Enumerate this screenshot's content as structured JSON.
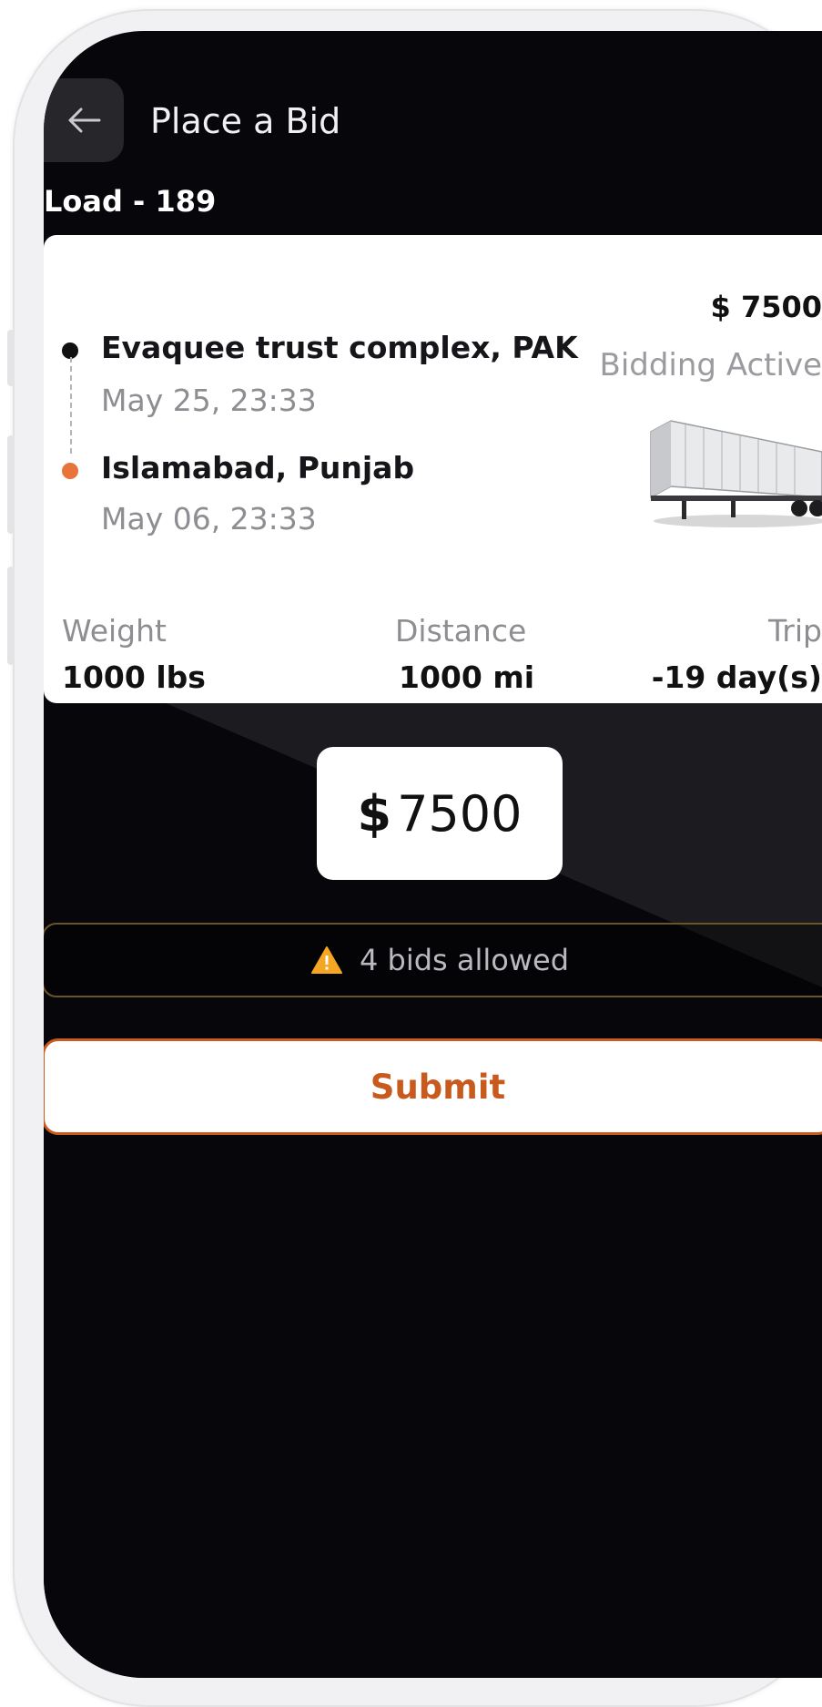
{
  "header": {
    "back_icon": "arrow-left-icon",
    "title": "Place a Bid"
  },
  "load": {
    "title": "Load - 189",
    "price": "$ 7500",
    "status": "Bidding Active",
    "pickup": {
      "location": "Evaquee trust complex, PAK",
      "date": "May 25, 23:33"
    },
    "dropoff": {
      "location": "Islamabad, Punjab",
      "date": "May 06, 23:33"
    },
    "stats": {
      "weight_label": "Weight",
      "weight_value": "1000 lbs",
      "distance_label": "Distance",
      "distance_value": "1000 mi",
      "trip_label": "Trip",
      "trip_value": "-19 day(s)"
    }
  },
  "bid": {
    "currency": "$",
    "amount": "7500"
  },
  "notice": {
    "icon": "warning-icon",
    "text": "4 bids allowed"
  },
  "actions": {
    "submit_label": "Submit"
  },
  "colors": {
    "accent": "#c85a1e",
    "pickup_dot": "#111111",
    "dropoff_dot": "#e8743b",
    "warning": "#f5a623",
    "background": "#07070b"
  }
}
